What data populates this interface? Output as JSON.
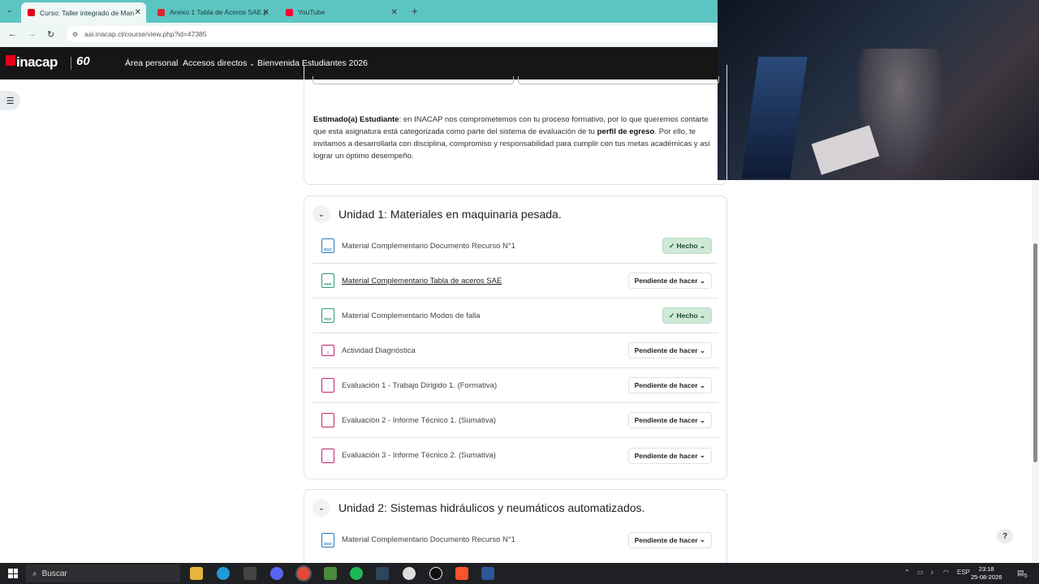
{
  "browser": {
    "tabs": [
      {
        "title": "Curso: Taller integrado de Man",
        "active": true,
        "color": "#e2001a"
      },
      {
        "title": "Anexo 1 Tabla de Aceros SAE.p",
        "active": false,
        "color": "#d9262e"
      },
      {
        "title": "YouTube",
        "active": false,
        "color": "#ff0033"
      }
    ],
    "new_tab": "+",
    "url": "aai.inacap.cl/course/view.php?id=47385"
  },
  "header": {
    "logo_text": "inacap",
    "logo_60": "60",
    "nav": [
      "Área personal",
      "Accesos directos",
      "Bienvenida Estudiantes 2026"
    ]
  },
  "intro": {
    "bold_lead": "Estimado(a) Estudiante",
    "text_1": ": en INACAP nos comprometemos con tu proceso formativo, por lo que queremos contarte que esta asignatura está categorizada como parte del sistema de evaluación de tu ",
    "bold_mid": "perfil de egreso",
    "text_2": ". Por ello, te invitamos a desarrollarla con disciplina, compromiso y responsabilidad para cumplir con tus metas académicas y así lograr un óptimo desempeño."
  },
  "units": [
    {
      "title": "Unidad 1: Materiales en maquinaria pesada.",
      "items": [
        {
          "title": "Material Complementario Documento Recurso N°1",
          "icon": "doc-icon",
          "icon_text": "DOC",
          "status": "Hecho",
          "done": true
        },
        {
          "title": "Material Complementario Tabla de aceros SAE",
          "icon": "pdf-icon",
          "icon_text": "PDF",
          "status": "Pendiente de hacer",
          "done": false,
          "hovered": true
        },
        {
          "title": "Material Complementario Modos de falla",
          "icon": "pdf-icon",
          "icon_text": "PDF",
          "status": "Hecho",
          "done": true
        },
        {
          "title": "Actividad Diagnóstica",
          "icon": "quiz-icon",
          "icon_text": "",
          "status": "Pendiente de hacer",
          "done": false
        },
        {
          "title": "Evaluación 1 - Trabajo Dirigido 1. (Formativa)",
          "icon": "assignment-icon",
          "icon_text": "",
          "status": "Pendiente de hacer",
          "done": false
        },
        {
          "title": "Evaluación 2 - Informe Técnico 1. (Sumativa)",
          "icon": "assignment-icon",
          "icon_text": "",
          "status": "Pendiente de hacer",
          "done": false
        },
        {
          "title": "Evaluación 3 - Informe Técnico 2. (Sumativa)",
          "icon": "assignment-icon",
          "icon_text": "",
          "status": "Pendiente de hacer",
          "done": false
        }
      ]
    },
    {
      "title": "Unidad 2: Sistemas hidráulicos y neumáticos automatizados.",
      "items": [
        {
          "title": "Material Complementario Documento Recurso N°1",
          "icon": "doc-icon",
          "icon_text": "DOC",
          "status": "Pendiente de hacer",
          "done": false
        }
      ]
    }
  ],
  "help": "?",
  "taskbar": {
    "search": "Buscar",
    "lang": "ESP",
    "time": "23:18",
    "date": "25-08-2026",
    "notifications": "5"
  }
}
